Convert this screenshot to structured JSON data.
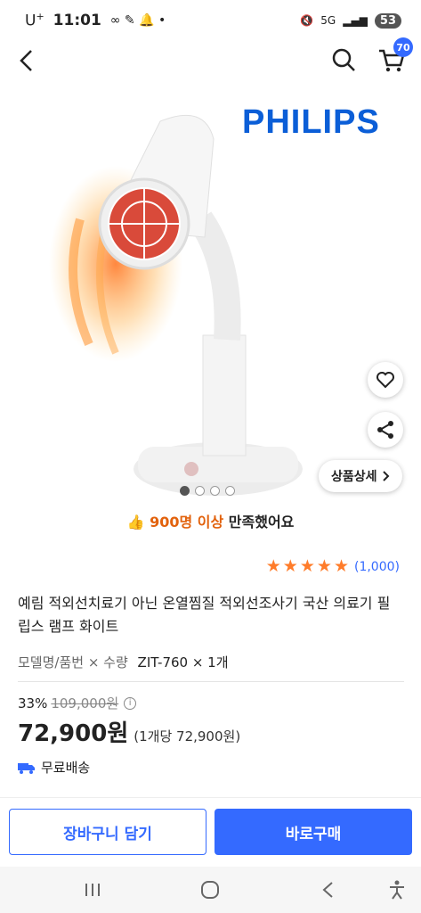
{
  "status_bar": {
    "carrier": "U",
    "carrier_sup": "+",
    "time": "11:01",
    "network": "5G",
    "battery": "53"
  },
  "header": {
    "cart_count": "70",
    "icons": [
      "back-arrow-icon",
      "search-icon",
      "cart-icon"
    ]
  },
  "product_image": {
    "brand": "PHILIPS",
    "detail_button": "상품상세",
    "slide_count": 4,
    "active_slide": 1
  },
  "satisfaction": {
    "count_text": "900명 이상",
    "rest_text": "만족했어요"
  },
  "rating": {
    "stars": 5,
    "review_count": "(1,000)"
  },
  "product": {
    "title": "예림 적외선치료기 아닌 온열찜질 적외선조사기 국산 의료기 필립스 램프 화이트",
    "option_label": "모델명/품번 × 수량",
    "option_value": "ZIT-760 × 1개",
    "discount_rate": "33%",
    "original_price": "109,000원",
    "price": "72,900원",
    "unit_price": "(1개당 72,900원)",
    "shipping": "무료배송"
  },
  "actions": {
    "add_to_cart": "장바구니 담기",
    "buy_now": "바로구매"
  },
  "colors": {
    "accent": "#346aff",
    "star": "#ff7c2a",
    "brand": "#0b5ed7"
  }
}
